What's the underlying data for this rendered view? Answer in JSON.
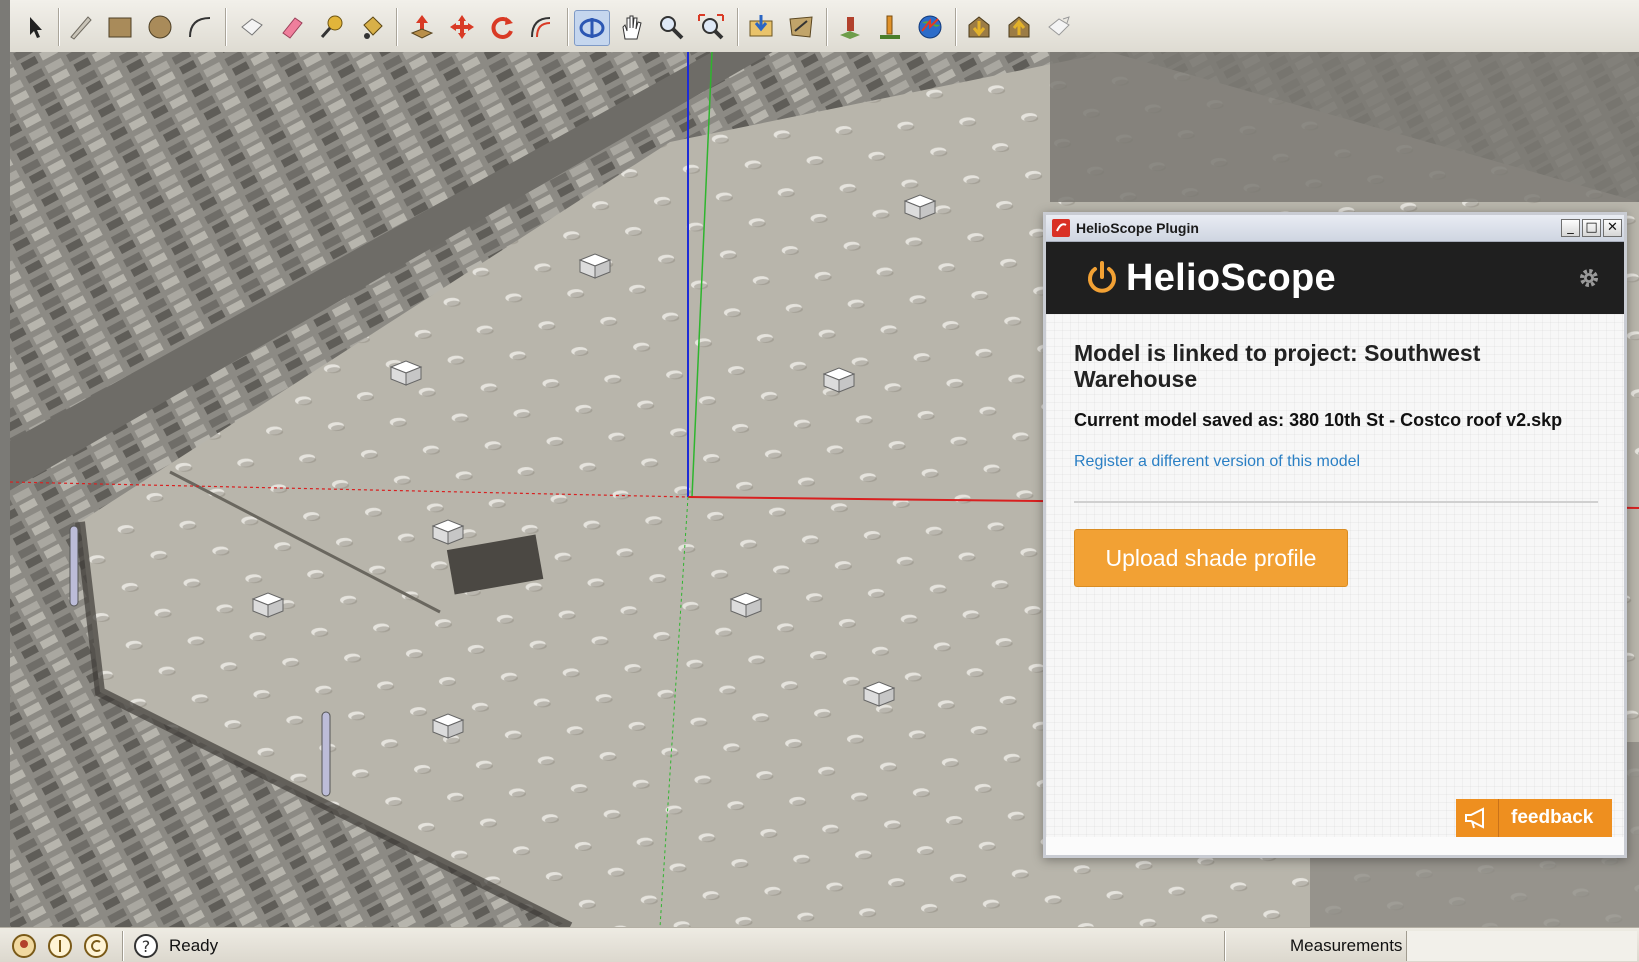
{
  "toolbar": {
    "buttons": [
      {
        "name": "select-tool-button",
        "icon": "arrow-cursor-icon"
      },
      {
        "name": "line-tool-button",
        "icon": "pencil-icon"
      },
      {
        "name": "rectangle-tool-button",
        "icon": "rectangle-icon"
      },
      {
        "name": "circle-tool-button",
        "icon": "circle-icon"
      },
      {
        "name": "arc-tool-button",
        "icon": "arc-icon"
      },
      {
        "name": "make-component-button",
        "icon": "component-icon"
      },
      {
        "name": "eraser-tool-button",
        "icon": "eraser-icon"
      },
      {
        "name": "tape-measure-button",
        "icon": "tape-measure-icon"
      },
      {
        "name": "paint-bucket-button",
        "icon": "paint-bucket-icon"
      },
      {
        "name": "push-pull-button",
        "icon": "push-pull-icon"
      },
      {
        "name": "move-tool-button",
        "icon": "move-arrows-icon"
      },
      {
        "name": "rotate-tool-button",
        "icon": "rotate-icon"
      },
      {
        "name": "offset-tool-button",
        "icon": "offset-icon"
      },
      {
        "name": "orbit-tool-button",
        "icon": "orbit-icon"
      },
      {
        "name": "pan-tool-button",
        "icon": "hand-icon"
      },
      {
        "name": "zoom-tool-button",
        "icon": "magnifier-icon"
      },
      {
        "name": "zoom-extents-button",
        "icon": "zoom-extents-icon"
      },
      {
        "name": "get-models-button",
        "icon": "get-models-icon"
      },
      {
        "name": "share-model-button",
        "icon": "share-model-icon"
      },
      {
        "name": "add-location-button",
        "icon": "add-location-icon"
      },
      {
        "name": "toggle-terrain-button",
        "icon": "terrain-icon"
      },
      {
        "name": "preview-earth-button",
        "icon": "globe-icon"
      },
      {
        "name": "get-photo-texture-button",
        "icon": "download-house-icon"
      },
      {
        "name": "upload-house-button",
        "icon": "upload-house-icon"
      },
      {
        "name": "share-component-button",
        "icon": "share-component-icon"
      }
    ]
  },
  "dialog": {
    "title": "HelioScope Plugin",
    "brand": "HelioScope",
    "linked_text": "Model is linked to project: Southwest Warehouse",
    "saved_text": "Current model saved as: 380 10th St - Costco roof v2.skp",
    "register_link": "Register a different version of this model",
    "upload_button": "Upload shade profile",
    "feedback_label": "feedback",
    "window_buttons": {
      "minimize": "_",
      "maximize": "□",
      "close": "✕"
    },
    "colors": {
      "accent": "#f2a134",
      "header": "#1f1f1f",
      "link": "#2a7fc4",
      "feedback": "#ee8f1f"
    }
  },
  "status": {
    "text": "Ready",
    "measurements_label": "Measurements",
    "measurements_value": ""
  }
}
